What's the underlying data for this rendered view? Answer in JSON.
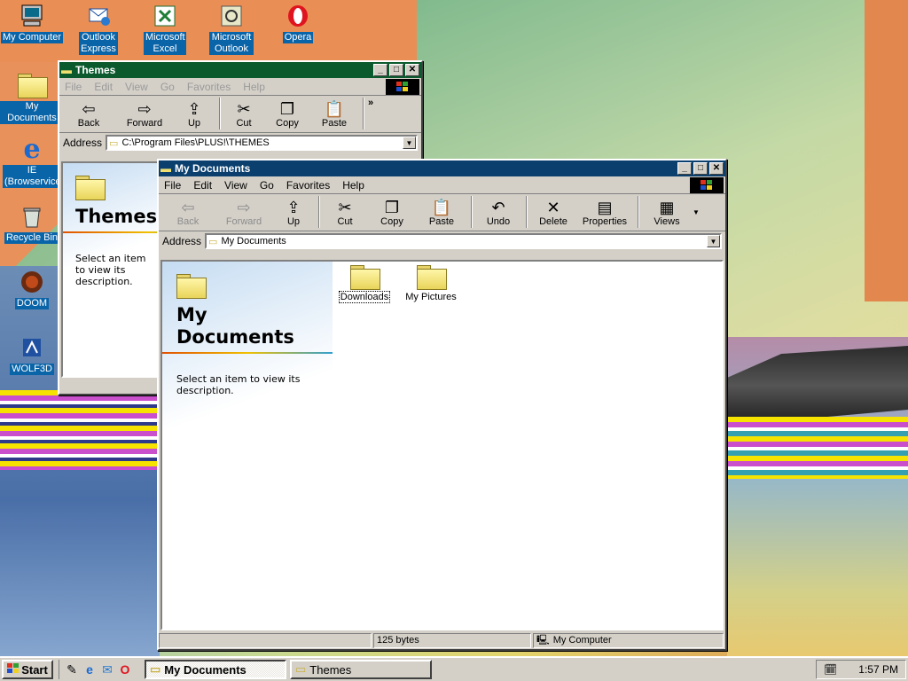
{
  "desktop": {
    "icons": [
      {
        "label": "My Computer",
        "icon": "computer-icon"
      },
      {
        "label": "Outlook Express",
        "icon": "outlook-express-icon"
      },
      {
        "label": "Microsoft Excel",
        "icon": "excel-icon"
      },
      {
        "label": "Microsoft Outlook",
        "icon": "outlook-icon"
      },
      {
        "label": "Opera",
        "icon": "opera-icon"
      },
      {
        "label": "My Documents",
        "icon": "folder-icon"
      },
      {
        "label": "IE (Browservice)",
        "icon": "ie-icon"
      },
      {
        "label": "Recycle Bin",
        "icon": "recycle-bin-icon"
      },
      {
        "label": "DOOM",
        "icon": "doom-icon"
      },
      {
        "label": "WOLF3D",
        "icon": "wolf3d-icon"
      }
    ]
  },
  "themes_window": {
    "title": "Themes",
    "menu": [
      "File",
      "Edit",
      "View",
      "Go",
      "Favorites",
      "Help"
    ],
    "toolbar": [
      "Back",
      "Forward",
      "Up",
      "Cut",
      "Copy",
      "Paste"
    ],
    "address_label": "Address",
    "address": "C:\\Program Files\\PLUS!\\THEMES",
    "side_title": "Themes",
    "side_text": "Select an item to view its description."
  },
  "docs_window": {
    "title": "My Documents",
    "menu": [
      "File",
      "Edit",
      "View",
      "Go",
      "Favorites",
      "Help"
    ],
    "toolbar": [
      "Back",
      "Forward",
      "Up",
      "Cut",
      "Copy",
      "Paste",
      "Undo",
      "Delete",
      "Properties",
      "Views"
    ],
    "address_label": "Address",
    "address": "My Documents",
    "side_title_1": "My",
    "side_title_2": "Documents",
    "side_text": "Select an item to view its description.",
    "items": [
      "Downloads",
      "My Pictures"
    ],
    "status_size": "125 bytes",
    "status_zone": "My Computer"
  },
  "taskbar": {
    "start": "Start",
    "tasks": [
      "My Documents",
      "Themes"
    ],
    "time": "1:57 PM"
  },
  "colors": {
    "active_title": "#0a3f6e",
    "inactive_title": "#0b5a2e"
  }
}
